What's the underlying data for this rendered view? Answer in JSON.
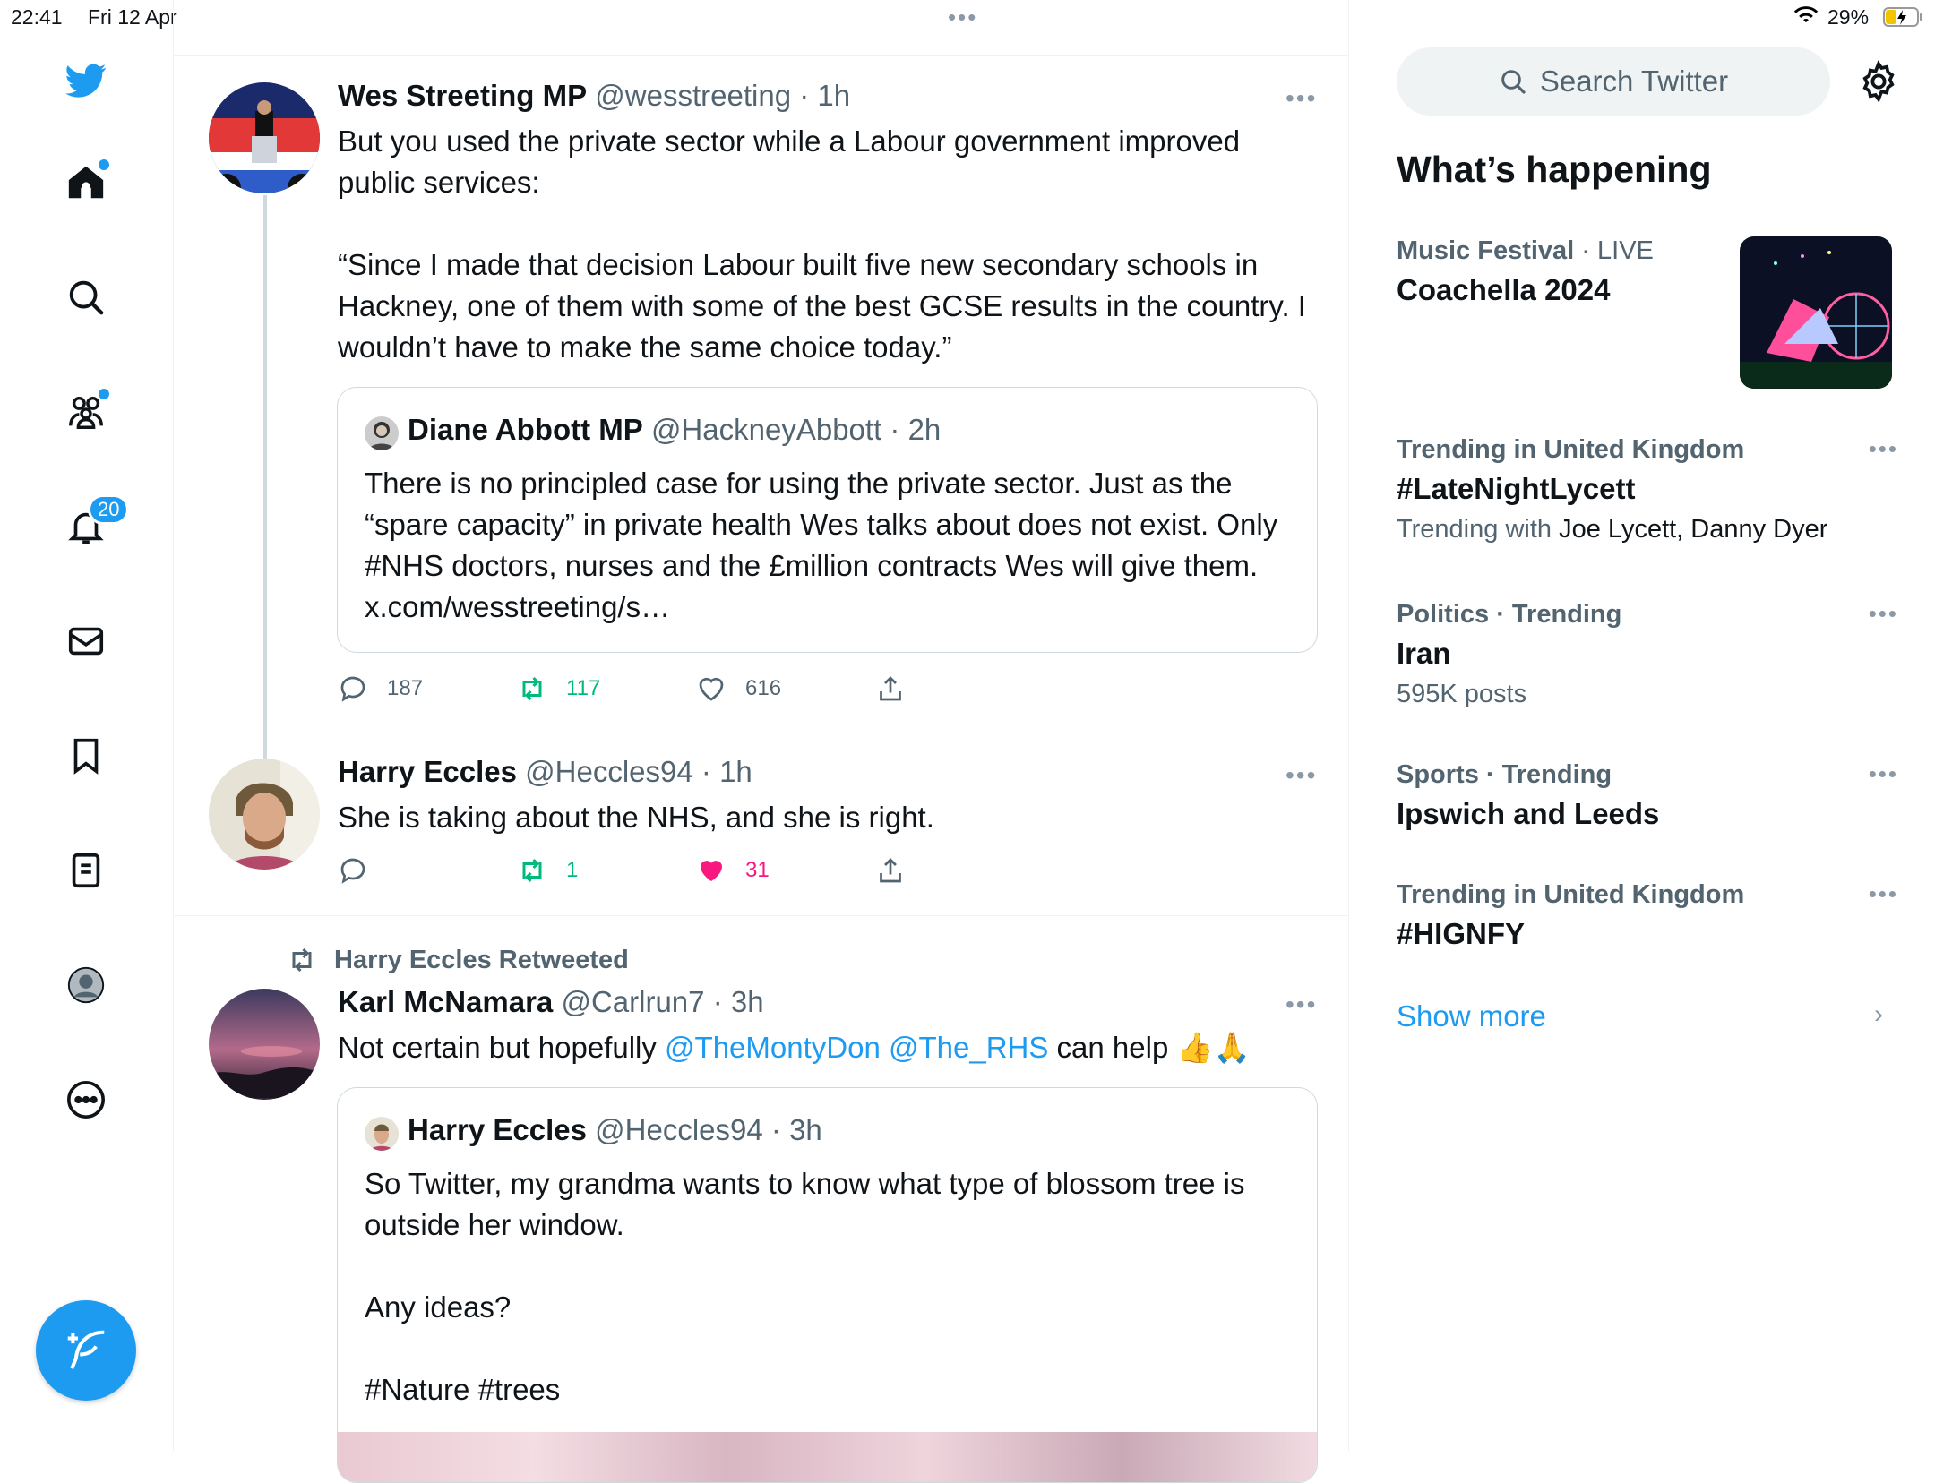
{
  "status_bar": {
    "time": "22:41",
    "date": "Fri 12 Apr",
    "battery": "29%"
  },
  "sidebar": {
    "communities_badge_dot": true,
    "notifications_count": "20"
  },
  "tweets": [
    {
      "name": "Wes Streeting MP",
      "handle": "@wesstreeting",
      "time": "· 1h",
      "text": "But you used the private sector while a Labour government improved public services:\n\n“Since I made that decision Labour built five new secondary schools in Hackney, one of them with some of the best GCSE results in the country. I wouldn’t have to make the same choice today.”",
      "quote": {
        "name": "Diane Abbott MP",
        "handle": "@HackneyAbbott",
        "time": "· 2h",
        "text": "There is no principled case for using the private sector. Just as the “spare capacity” in private health Wes talks about does not exist. Only #NHS doctors, nurses and the £million contracts Wes will give them. x.com/wesstreeting/s…"
      },
      "replies": "187",
      "retweets": "117",
      "likes": "616"
    },
    {
      "name": "Harry Eccles",
      "handle": "@Heccles94",
      "time": "· 1h",
      "text": "She is taking about the NHS, and she is right.",
      "replies": "",
      "retweets": "1",
      "likes": "31"
    },
    {
      "retweeted_by": "Harry Eccles Retweeted",
      "name": "Karl McNamara",
      "handle": "@Carlrun7",
      "time": "· 3h",
      "text_prefix": "Not certain but hopefully ",
      "mention1": "@TheMontyDon",
      "mention2": "@The_RHS",
      "text_suffix": " can help 👍🙏",
      "quote": {
        "name": "Harry Eccles",
        "handle": "@Heccles94",
        "time": "· 3h",
        "text": "So Twitter, my grandma wants to know what type of blossom tree is outside her window.\n\nAny ideas?\n\n#Nature #trees"
      }
    }
  ],
  "right": {
    "search_placeholder": "Search Twitter",
    "happening_title": "What’s happening",
    "trends": [
      {
        "meta_a": "Music Festival",
        "meta_b": " · LIVE",
        "title": "Coachella 2024"
      },
      {
        "meta": "Trending in United Kingdom",
        "title": "#LateNightLycett",
        "sub_a": "Trending with ",
        "sub_b": "Joe Lycett, Danny Dyer"
      },
      {
        "meta": "Politics · Trending",
        "title": "Iran",
        "sub": "595K posts"
      },
      {
        "meta": "Sports · Trending",
        "title": "Ipswich and Leeds"
      },
      {
        "meta": "Trending in United Kingdom",
        "title": "#HIGNFY"
      }
    ],
    "show_more": "Show more"
  },
  "colors": {
    "accent": "#1d9bf0",
    "retweet": "#00ba7c",
    "like": "#f91880",
    "secondary_text": "#536471"
  },
  "icons": [
    "twitter-bird-icon",
    "home-icon",
    "search-icon",
    "communities-icon",
    "bell-icon",
    "mail-icon",
    "bookmark-icon",
    "list-icon",
    "profile-icon",
    "more-circle-icon",
    "compose-icon",
    "reply-icon",
    "retweet-icon",
    "like-icon",
    "share-icon",
    "gear-icon",
    "chevron-right-icon",
    "wifi-icon",
    "battery-icon"
  ]
}
